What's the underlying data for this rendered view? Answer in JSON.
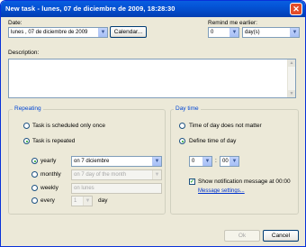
{
  "window": {
    "title": "New task - lunes, 07 de diciembre de 2009, 18:28:30",
    "close_glyph": "✕"
  },
  "date": {
    "label": "Date:",
    "value": "lunes   , 07 de  diciembre  de 2009",
    "calendar_button": "Calendar..."
  },
  "remind": {
    "label": "Remind me earlier:",
    "amount": "0",
    "unit": "day(s)"
  },
  "description": {
    "label": "Description:",
    "value": ""
  },
  "repeating": {
    "title": "Repeating",
    "once_label": "Task is scheduled only once",
    "repeated_label": "Task is repeated",
    "selected": "repeated",
    "options": [
      {
        "label": "yearly",
        "value": "on 7 diciembre",
        "selected": true,
        "enabled": true
      },
      {
        "label": "monthly",
        "value": "on 7 day of the month",
        "selected": false,
        "enabled": false
      },
      {
        "label": "weekly",
        "value": "on lunes",
        "selected": false,
        "enabled": false
      },
      {
        "label": "every",
        "value": "1",
        "suffix": "day",
        "selected": false,
        "enabled": false
      }
    ]
  },
  "daytime": {
    "title": "Day time",
    "no_time_label": "Time of day does not matter",
    "define_label": "Define time of day",
    "hour": "0",
    "minute": "00",
    "separator": ":",
    "show_notification_label": "Show notification message at 00:00",
    "show_notification_checked": true,
    "message_settings_link": "Message settings..."
  },
  "buttons": {
    "ok": "Ok",
    "cancel": "Cancel"
  }
}
